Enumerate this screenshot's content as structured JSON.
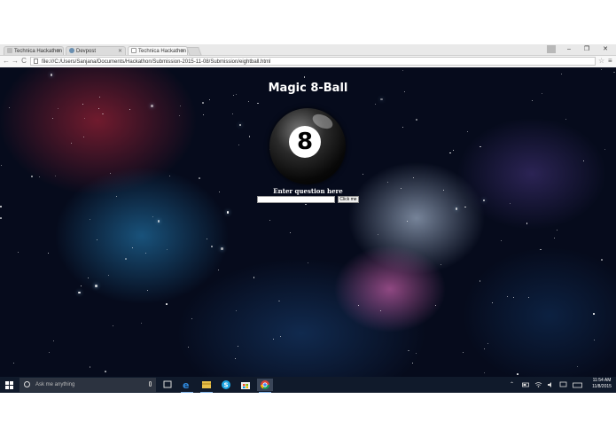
{
  "browser": {
    "tabs": [
      {
        "label": "Technica Hackathon",
        "active": false
      },
      {
        "label": "Devpost",
        "active": false
      },
      {
        "label": "Technica Hackathon",
        "active": true
      }
    ],
    "address": "file:///C:/Users/Sanjana/Documents/Hackathon/Submission-2015-11-08/Submission/eightball.html",
    "window_controls": {
      "user": "",
      "minimize": "–",
      "restore": "❐",
      "close": "✕"
    },
    "nav": {
      "back": "←",
      "forward": "→",
      "reload": "C"
    }
  },
  "page": {
    "title": "Magic 8-Ball",
    "ball_number": "8",
    "prompt": "Enter question here",
    "input_value": "",
    "button_label": "Click me"
  },
  "taskbar": {
    "search_placeholder": "Ask me anything",
    "clock_time": "11:54 AM",
    "clock_date": "11/8/2015",
    "accent": "#7fb2e8"
  }
}
